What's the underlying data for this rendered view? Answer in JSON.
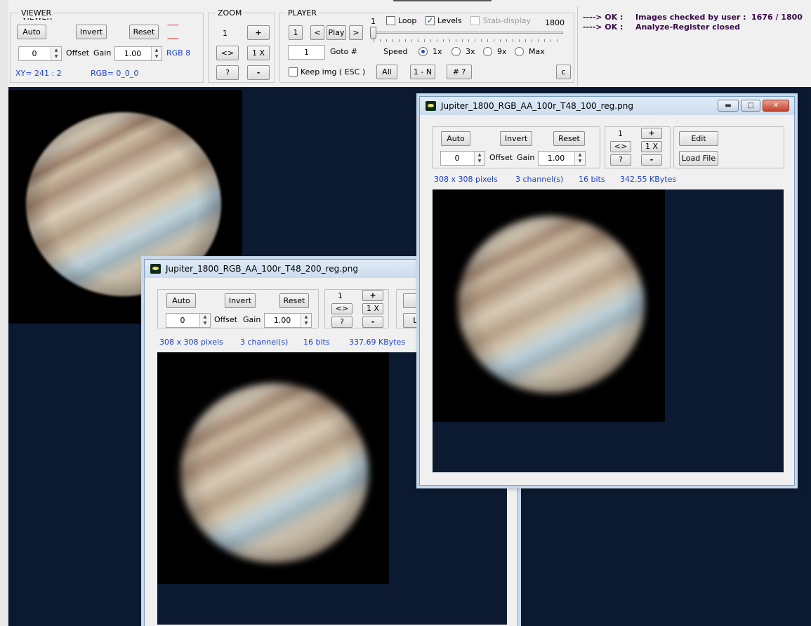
{
  "viewer": {
    "title": "VIEWER",
    "auto": "Auto",
    "invert": "Invert",
    "reset": "Reset",
    "offset_value": "0",
    "offset_label": "Offset",
    "gain_label": "Gain",
    "gain_value": "1.00",
    "rgb_mode": "RGB 8",
    "xy_readout": "XY=  241 : 2",
    "rgb_readout": "RGB=  0_0_0",
    "red_marks": [
      "-------",
      "-------"
    ]
  },
  "zoom": {
    "title": "ZOOM",
    "level": "1",
    "plus": "+",
    "fit": "<>",
    "one_x": "1 X",
    "help": "?",
    "minus": "-"
  },
  "player": {
    "title": "PLAYER",
    "first": "1",
    "prev": "<",
    "play": "Play",
    "next": ">",
    "slider_min": "1",
    "slider_max": "1800",
    "slider_fraction": 0,
    "loop_label": "Loop",
    "loop_checked": false,
    "levels_label": "Levels",
    "levels_checked": true,
    "stab_label": "Stab-display",
    "stab_checked": false,
    "goto_value": "1",
    "goto_label": "Goto #",
    "speed_label": "Speed",
    "speeds": [
      "1x",
      "3x",
      "9x",
      "Max"
    ],
    "speed_selected": "1x",
    "keep_label": "Keep img ( ESC )",
    "keep_checked": false,
    "all": "All",
    "one_n": "1 - N",
    "hash": "# ?",
    "c": "c"
  },
  "status": {
    "line1_prefix": "----> OK :",
    "line1_text": "Images checked by user :",
    "line1_value": "1676 / 1800",
    "line2_prefix": "----> OK :",
    "line2_text": "Analyze-Register closed"
  },
  "windows": [
    {
      "title": "Jupiter_1800_RGB_AA_100r_T48_100_reg.png",
      "auto": "Auto",
      "invert": "Invert",
      "reset": "Reset",
      "offset_value": "0",
      "offset_label": "Offset",
      "gain_label": "Gain",
      "gain_value": "1.00",
      "zoom_level": "1",
      "plus": "+",
      "fit": "<>",
      "one_x": "1 X",
      "help": "?",
      "minus": "-",
      "edit": "Edit",
      "load": "Load File",
      "dims": "308  x  308  pixels",
      "channels": "3  channel(s)",
      "bits": "16 bits",
      "size": "342.55  KBytes"
    },
    {
      "title": "Jupiter_1800_RGB_AA_100r_T48_200_reg.png",
      "auto": "Auto",
      "invert": "Invert",
      "reset": "Reset",
      "offset_value": "0",
      "offset_label": "Offset",
      "gain_label": "Gain",
      "gain_value": "1.00",
      "zoom_level": "1",
      "plus": "+",
      "fit": "<>",
      "one_x": "1 X",
      "help": "?",
      "minus": "-",
      "edit": "E",
      "load": "Loa",
      "dims": "308  x  308  pixels",
      "channels": "3  channel(s)",
      "bits": "16 bits",
      "size": "337.69  KBytes"
    }
  ]
}
